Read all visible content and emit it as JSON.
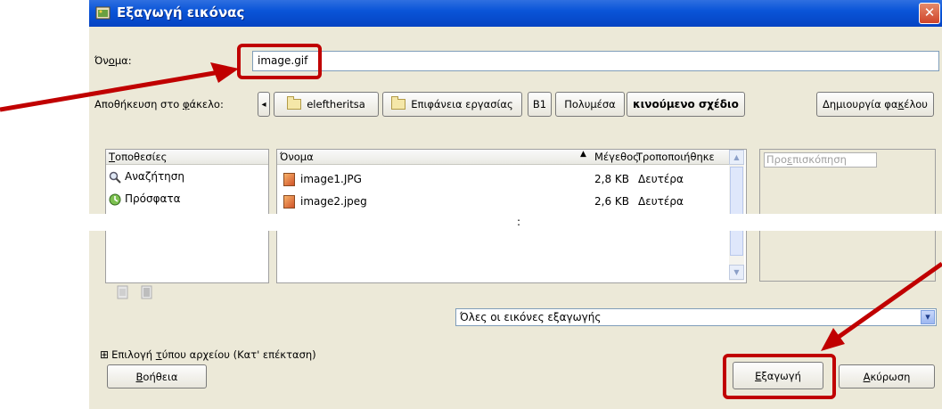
{
  "dialog": {
    "title": "Εξαγωγή εικόνας",
    "close_glyph": "✕"
  },
  "name_row": {
    "label_pre": "Όν",
    "label_ul": "ο",
    "label_post": "μα:",
    "value": "image.gif"
  },
  "save_in": {
    "label_pre": "Αποθήκευση στο ",
    "label_ul": "φ",
    "label_post": "άκελο:",
    "back_glyph": "◂",
    "path": [
      "eleftheritsa",
      "Επιφάνεια εργασίας",
      "B1",
      "Πολυμέσα",
      "κινούμενο σχέδιο"
    ],
    "create_folder_pre": "Δημιουργία φα",
    "create_folder_ul": "κ",
    "create_folder_post": "έλου"
  },
  "places": {
    "header_ul": "Τ",
    "header_post": "οποθεσίες",
    "items": [
      "Αναζήτηση",
      "Πρόσφατα"
    ]
  },
  "files": {
    "col_name": "Όνομα",
    "sort_glyph": "▲",
    "col_size": "Μέγεθος",
    "col_modified": "Τροποποιήθηκε",
    "rows": [
      {
        "name": "image1.JPG",
        "size": "2,8 KB",
        "modified": "Δευτέρα"
      },
      {
        "name": "image2.jpeg",
        "size": "2,6 KB",
        "modified": "Δευτέρα"
      }
    ],
    "ellipsis": ":"
  },
  "preview": {
    "label_pre": "Προ",
    "label_ul": "ε",
    "label_post": "πισκόπηση"
  },
  "filter": {
    "value": "Όλες οι εικόνες εξαγωγής",
    "arrow_glyph": "▾"
  },
  "file_type": {
    "expander_glyph": "⊞",
    "label_pre": "Επιλογή ",
    "label_ul": "τ",
    "label_post": "ύπου αρχείου (Κατ' επέκταση)"
  },
  "buttons": {
    "help_ul": "Β",
    "help_post": "οήθεια",
    "export_ul": "Ε",
    "export_post": "ξαγωγή",
    "cancel_ul": "Α",
    "cancel_post": "κύρωση"
  },
  "colors": {
    "annotation": "#c00000",
    "titlebar": "#0a55d8",
    "dialog_bg": "#ece9d8"
  }
}
